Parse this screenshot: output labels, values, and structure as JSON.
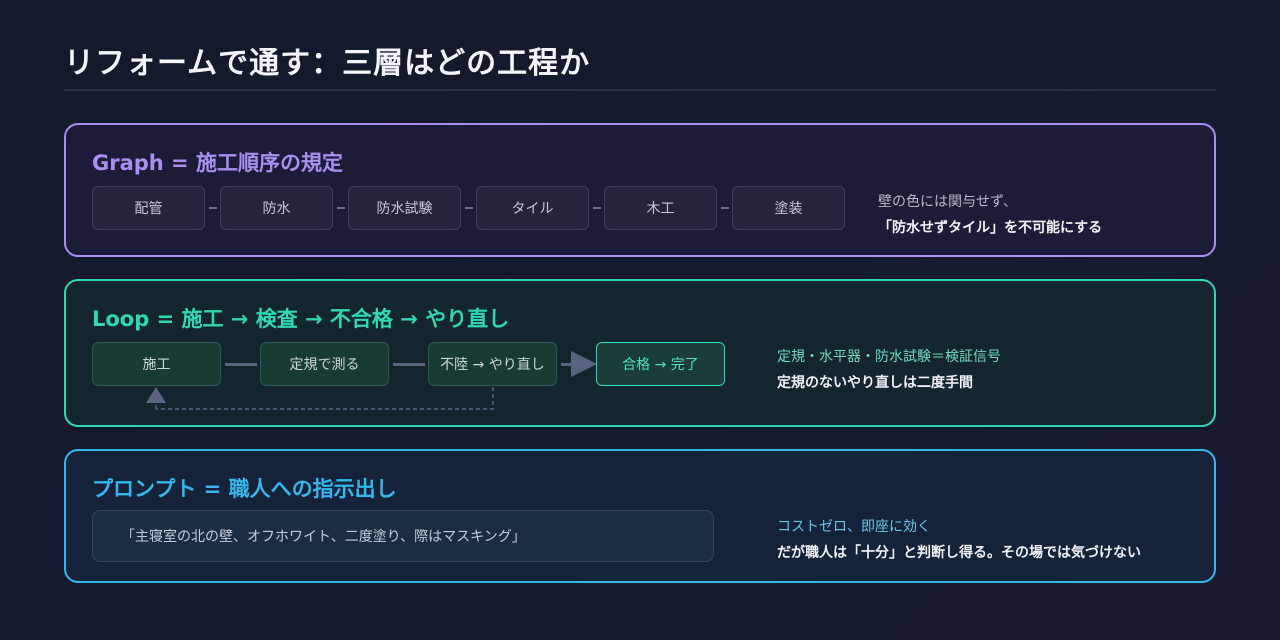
{
  "title": "リフォームで通す：三層はどの工程か",
  "graph": {
    "title": "Graph = 施工順序の規定",
    "steps": [
      "配管",
      "防水",
      "防水試験",
      "タイル",
      "木工",
      "塗装"
    ],
    "note_sub": "壁の色には関与せず、",
    "note_main": "「防水せずタイル」を不可能にする"
  },
  "loop": {
    "title": "Loop = 施工 → 検査 → 不合格 → やり直し",
    "steps": [
      "施工",
      "定規で測る",
      "不陸 → やり直し",
      "合格 → 完了"
    ],
    "note_sub": "定規・水平器・防水試験＝検証信号",
    "note_main": "定規のないやり直しは二度手間"
  },
  "prompt": {
    "title": "プロンプト = 職人への指示出し",
    "instruction": "「主寝室の北の壁、オフホワイト、二度塗り、際はマスキング」",
    "note_sub": "コストゼロ、即座に効く",
    "note_main": "だが職人は「十分」と判断し得る。その場では気づけない"
  },
  "colors": {
    "graph_accent": "#a98ff0",
    "loop_accent": "#2fd8b4",
    "prompt_accent": "#35b7ee"
  }
}
